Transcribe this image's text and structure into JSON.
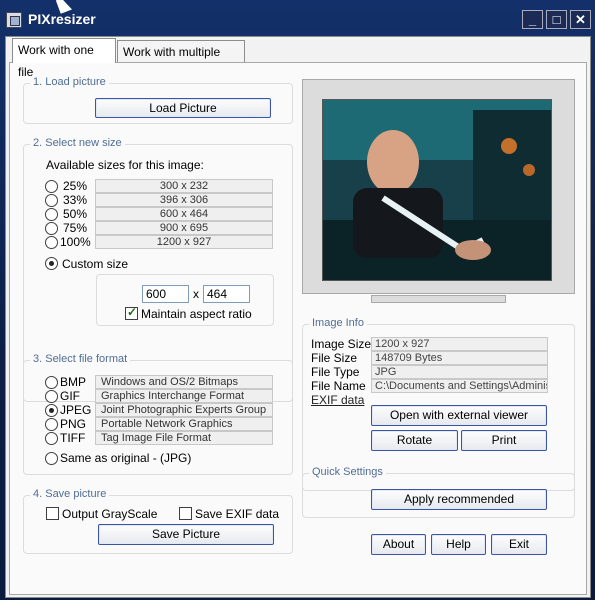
{
  "window": {
    "title": "PIXresizer",
    "minimize": "_",
    "maximize": "□",
    "close": "✕"
  },
  "tabs": [
    "Work with one file",
    "Work with multiple files"
  ],
  "load": {
    "group_title": "1. Load picture",
    "button": "Load Picture"
  },
  "size": {
    "group_title": "2. Select new size",
    "available_label": "Available sizes for this image:",
    "options": [
      {
        "percent": "25%",
        "dims": "300 x 232"
      },
      {
        "percent": "33%",
        "dims": "396 x 306"
      },
      {
        "percent": "50%",
        "dims": "600 x 464"
      },
      {
        "percent": "75%",
        "dims": "900 x 695"
      },
      {
        "percent": "100%",
        "dims": "1200 x 927"
      }
    ],
    "custom_label": "Custom size",
    "custom_width": "600",
    "times": "x",
    "custom_height": "464",
    "aspect_label": "Maintain aspect ratio"
  },
  "format": {
    "group_title": "3. Select file format",
    "options": [
      {
        "name": "BMP",
        "desc": "Windows and OS/2 Bitmaps"
      },
      {
        "name": "GIF",
        "desc": "Graphics Interchange Format"
      },
      {
        "name": "JPEG",
        "desc": "Joint Photographic Experts Group"
      },
      {
        "name": "PNG",
        "desc": "Portable Network Graphics"
      },
      {
        "name": "TIFF",
        "desc": "Tag Image File Format"
      }
    ],
    "selected": "JPEG",
    "same_as_original": "Same as original  - (JPG)"
  },
  "save": {
    "group_title": "4. Save picture",
    "grayscale_label": "Output GrayScale",
    "exif_label": "Save EXIF data",
    "button": "Save Picture"
  },
  "image_info": {
    "group_title": "Image Info",
    "rows": [
      {
        "label": "Image Size",
        "value": "1200 x 927"
      },
      {
        "label": "File Size",
        "value": "148709 Bytes"
      },
      {
        "label": "File Type",
        "value": "JPG"
      },
      {
        "label": "File Name",
        "value": "C:\\Documents and Settings\\Adminis"
      }
    ],
    "exif_link": "EXIF data",
    "open_external": "Open with external viewer",
    "rotate": "Rotate",
    "print": "Print"
  },
  "quick": {
    "group_title": "Quick Settings",
    "apply": "Apply recommended"
  },
  "footer": {
    "about": "About",
    "help": "Help",
    "exit": "Exit"
  }
}
